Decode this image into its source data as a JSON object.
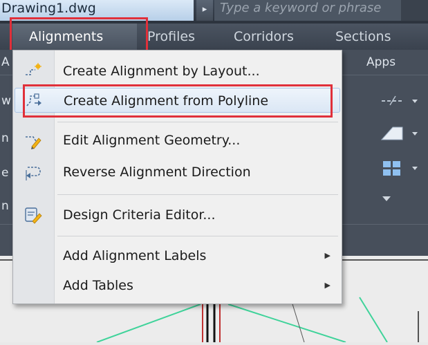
{
  "titlebar": {
    "file_name": "Drawing1.dwg",
    "arrow": "▸",
    "search_placeholder": "Type a keyword or phrase"
  },
  "tabs": [
    {
      "label": "Alignments",
      "active": true
    },
    {
      "label": "Profiles"
    },
    {
      "label": "Corridors"
    },
    {
      "label": "Sections"
    }
  ],
  "ribbon": {
    "apps_label": "Apps",
    "side_letters": [
      "A",
      "w",
      "n",
      "e",
      "n"
    ]
  },
  "menu": {
    "items": [
      {
        "label": "Create Alignment by Layout...",
        "icon": "create-alignment-layout-icon"
      },
      {
        "label": "Create Alignment from Polyline",
        "icon": "create-alignment-polyline-icon"
      },
      {
        "label": "Edit Alignment Geometry...",
        "icon": "edit-geometry-icon"
      },
      {
        "label": "Reverse Alignment Direction",
        "icon": "reverse-direction-icon"
      },
      {
        "label": "Design Criteria Editor...",
        "icon": "design-criteria-icon"
      },
      {
        "label": "Add Alignment Labels",
        "submenu": "▶"
      },
      {
        "label": "Add Tables",
        "submenu": "▶"
      }
    ]
  },
  "colors": {
    "highlight": "#e0303a",
    "canvas_green": "#3fd39a"
  }
}
